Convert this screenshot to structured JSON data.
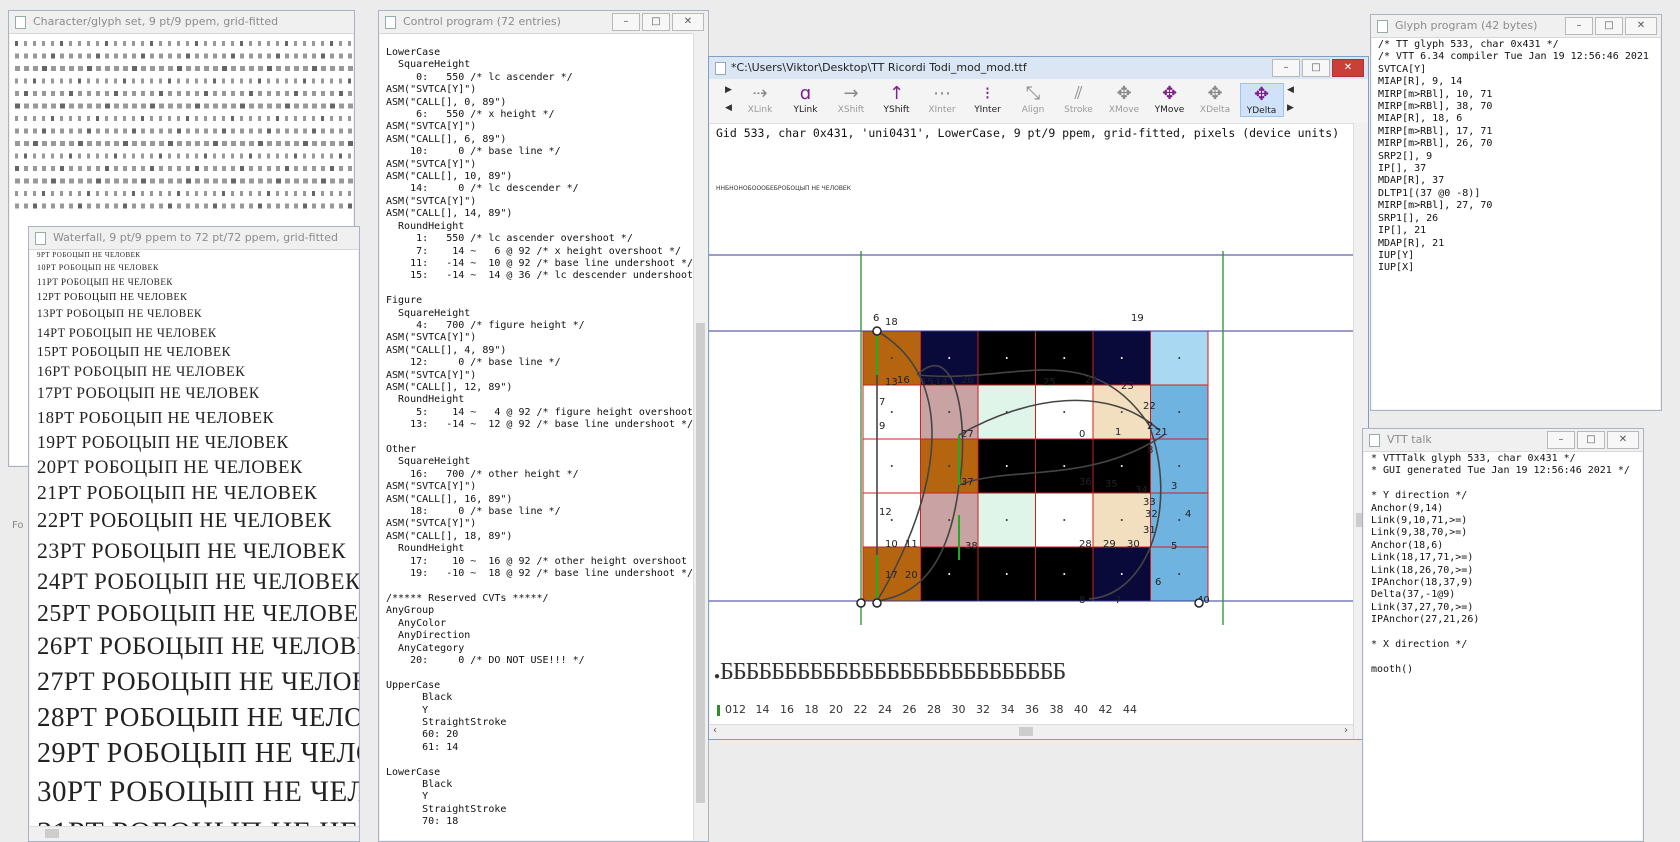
{
  "charset_window": {
    "title": "Character/glyph set, 9 pt/9 ppem, grid-fitted"
  },
  "waterfall_window": {
    "title": "Waterfall, 9 pt/9 ppem to 72 pt/72 ppem, grid-fitted",
    "sample_text": "РОБОЦЫП НЕ ЧЕЛОВЕК",
    "rows": [
      "9PT",
      "10PT",
      "11PT",
      "12PT",
      "13PT",
      "14PT",
      "15PT",
      "16PT",
      "17PT",
      "18PT",
      "19PT",
      "20PT",
      "21PT",
      "22PT",
      "23PT",
      "24PT",
      "25PT",
      "26PT",
      "27PT",
      "28PT",
      "29PT",
      "30PT",
      "31PT"
    ]
  },
  "left_edge_label": "Fo",
  "control_window": {
    "title": "Control program (72 entries)",
    "lines": [
      "LowerCase",
      "  SquareHeight",
      "     0:   550 /* lc ascender */",
      "ASM(\"SVTCA[Y]\")",
      "ASM(\"CALL[], 0, 89\")",
      "     6:   550 /* x height */",
      "ASM(\"SVTCA[Y]\")",
      "ASM(\"CALL[], 6, 89\")",
      "    10:     0 /* base line */",
      "ASM(\"SVTCA[Y]\")",
      "ASM(\"CALL[], 10, 89\")",
      "    14:     0 /* lc descender */",
      "ASM(\"SVTCA[Y]\")",
      "ASM(\"CALL[], 14, 89\")",
      "  RoundHeight",
      "     1:   550 /* lc ascender overshoot */",
      "     7:    14 ~   6 @ 92 /* x height overshoot */",
      "    11:   -14 ~  10 @ 92 /* base line undershoot */",
      "    15:   -14 ~  14 @ 36 /* lc descender undershoot */",
      "",
      "Figure",
      "  SquareHeight",
      "     4:   700 /* figure height */",
      "ASM(\"SVTCA[Y]\")",
      "ASM(\"CALL[], 4, 89\")",
      "    12:     0 /* base line */",
      "ASM(\"SVTCA[Y]\")",
      "ASM(\"CALL[], 12, 89\")",
      "  RoundHeight",
      "     5:    14 ~   4 @ 92 /* figure height overshoot */",
      "    13:   -14 ~  12 @ 92 /* base line undershoot */",
      "",
      "Other",
      "  SquareHeight",
      "    16:   700 /* other height */",
      "ASM(\"SVTCA[Y]\")",
      "ASM(\"CALL[], 16, 89\")",
      "    18:     0 /* base line */",
      "ASM(\"SVTCA[Y]\")",
      "ASM(\"CALL[], 18, 89\")",
      "  RoundHeight",
      "    17:    10 ~  16 @ 92 /* other height overshoot */",
      "    19:   -10 ~  18 @ 92 /* base line undershoot */",
      "",
      "/***** Reserved CVTs *****/",
      "AnyGroup",
      "  AnyColor",
      "  AnyDirection",
      "  AnyCategory",
      "    20:     0 /* DO NOT USE!!! */",
      "",
      "UpperCase",
      "      Black",
      "      Y",
      "      StraightStroke",
      "      60: 20",
      "      61: 14",
      "",
      "LowerCase",
      "      Black",
      "      Y",
      "      StraightStroke",
      "      70: 18"
    ]
  },
  "main_window": {
    "title": "*C:\\Users\\Viktor\\Desktop\\TT Ricordi Todi_mod_mod.ttf",
    "info": "Gid 533, char 0x431, 'uni0431', LowerCase, 9 pt/9 ppem, grid-fitted, pixels (device units)",
    "tiny_sample": "ННБНОНОБОООБЕБРОБОЦЫП НЕ ЧЕЛОВЕК",
    "big_sample": "БББББББББББББББББББББББББББ",
    "tools": [
      {
        "label": "XLink",
        "icon": "⇢",
        "state": "off"
      },
      {
        "label": "YLink",
        "icon": "ɑ",
        "state": "on"
      },
      {
        "label": "XShift",
        "icon": "→",
        "state": "off"
      },
      {
        "label": "YShift",
        "icon": "↑",
        "state": "on"
      },
      {
        "label": "XInter",
        "icon": "⋯",
        "state": "off"
      },
      {
        "label": "YInter",
        "icon": "⁝",
        "state": "on"
      },
      {
        "label": "Align",
        "icon": "⤡",
        "state": "off"
      },
      {
        "label": "Stroke",
        "icon": "⫽",
        "state": "off"
      },
      {
        "label": "XMove",
        "icon": "✥",
        "state": "off"
      },
      {
        "label": "YMove",
        "icon": "✥",
        "state": "on"
      },
      {
        "label": "XDelta",
        "icon": "✥",
        "state": "off"
      },
      {
        "label": "YDelta",
        "icon": "✥",
        "state": "sel"
      }
    ],
    "ruler": [
      "012",
      "14",
      "16",
      "18",
      "20",
      "22",
      "24",
      "26",
      "28",
      "30",
      "32",
      "34",
      "36",
      "38",
      "40",
      "42",
      "44"
    ],
    "points": [
      "18",
      "19",
      "6",
      "7",
      "13",
      "16",
      "15",
      "14",
      "26",
      "25",
      "24",
      "23",
      "27",
      "0",
      "1",
      "22",
      "2",
      "21",
      "8",
      "3",
      "9",
      "12",
      "37",
      "36",
      "35",
      "34",
      "33",
      "32",
      "31",
      "4",
      "5",
      "10",
      "11",
      "38",
      "28",
      "29",
      "30",
      "6",
      "17",
      "20",
      "40",
      "8",
      "7"
    ]
  },
  "glyph_program_window": {
    "title": "Glyph program (42 bytes)",
    "lines": [
      "/* TT glyph 533, char 0x431 */",
      "/* VTT 6.34 compiler Tue Jan 19 12:56:46 2021",
      "SVTCA[Y]",
      "MIAP[R], 9, 14",
      "MIRP[m>RBl], 10, 71",
      "MIRP[m>RBl], 38, 70",
      "MIAP[R], 18, 6",
      "MIRP[m>RBl], 17, 71",
      "MIRP[m>RBl], 26, 70",
      "SRP2[], 9",
      "IP[], 37",
      "MDAP[R], 37",
      "DLTP1[(37 @0 -8)]",
      "MIRP[m>RBl], 27, 70",
      "SRP1[], 26",
      "IP[], 21",
      "MDAP[R], 21",
      "IUP[Y]",
      "IUP[X]"
    ]
  },
  "vtt_talk_window": {
    "title": "VTT talk",
    "lines": [
      "* VTTTalk glyph 533, char 0x431 */",
      "* GUI generated Tue Jan 19 12:56:46 2021 */",
      "",
      "* Y direction */",
      "Anchor(9,14)",
      "Link(9,10,71,>=)",
      "Link(9,38,70,>=)",
      "Anchor(18,6)",
      "Link(18,17,71,>=)",
      "Link(18,26,70,>=)",
      "IPAnchor(18,37,9)",
      "Delta(37,-1@9)",
      "Link(37,27,70,>=)",
      "IPAnchor(27,21,26)",
      "",
      "* X direction */",
      "",
      "mooth()"
    ]
  },
  "colors": {
    "pixel_brown": "#b5650f",
    "pixel_pink": "#c9a3a3",
    "pixel_mint": "#dff5ea",
    "pixel_cream": "#f2dfc0",
    "pixel_blue_light": "#a8d8f2",
    "pixel_blue": "#6fb3e0",
    "pixel_navy": "#0a0a3a",
    "grid_line": "#cc2222",
    "guide_blue": "#3a3a9a",
    "guide_green": "#2f8f2f"
  }
}
